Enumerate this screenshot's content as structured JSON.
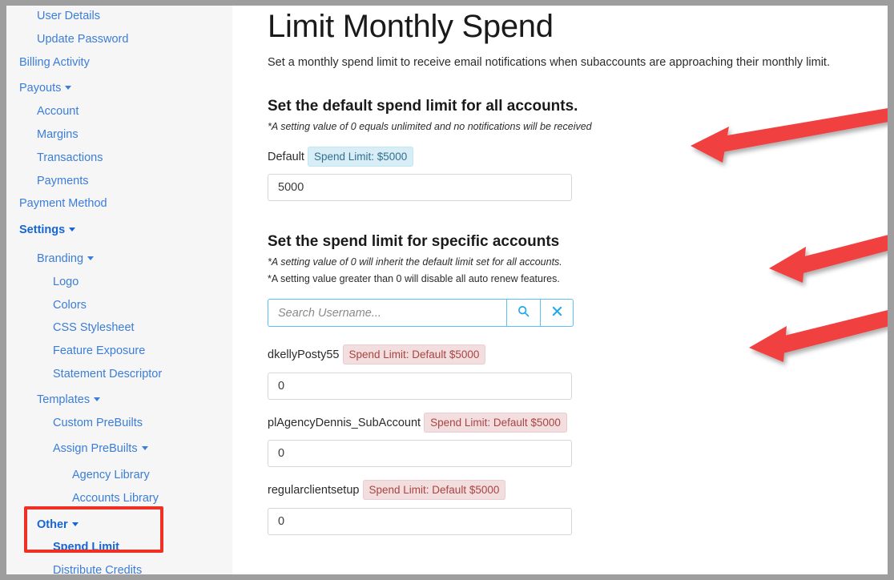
{
  "sidebar": {
    "items": [
      {
        "label": "User Details",
        "level": 2,
        "bold": false,
        "caret": false
      },
      {
        "label": "Update Password",
        "level": 2,
        "bold": false,
        "caret": false
      },
      {
        "label": "Billing Activity",
        "level": 1,
        "bold": false,
        "caret": false
      },
      {
        "label": "Payouts",
        "level": 1,
        "bold": false,
        "caret": true
      },
      {
        "label": "Account",
        "level": 2,
        "bold": false,
        "caret": false
      },
      {
        "label": "Margins",
        "level": 2,
        "bold": false,
        "caret": false
      },
      {
        "label": "Transactions",
        "level": 2,
        "bold": false,
        "caret": false
      },
      {
        "label": "Payments",
        "level": 2,
        "bold": false,
        "caret": false
      },
      {
        "label": "Payment Method",
        "level": 1,
        "bold": false,
        "caret": false
      },
      {
        "label": "Settings",
        "level": 1,
        "bold": true,
        "caret": true
      },
      {
        "label": "Branding",
        "level": 2,
        "bold": false,
        "caret": true
      },
      {
        "label": "Logo",
        "level": 3,
        "bold": false,
        "caret": false
      },
      {
        "label": "Colors",
        "level": 3,
        "bold": false,
        "caret": false
      },
      {
        "label": "CSS Stylesheet",
        "level": 3,
        "bold": false,
        "caret": false
      },
      {
        "label": "Feature Exposure",
        "level": 3,
        "bold": false,
        "caret": false
      },
      {
        "label": "Statement Descriptor",
        "level": 3,
        "bold": false,
        "caret": false
      },
      {
        "label": "Templates",
        "level": 2,
        "bold": false,
        "caret": true
      },
      {
        "label": "Custom PreBuilts",
        "level": 3,
        "bold": false,
        "caret": false
      },
      {
        "label": "Assign PreBuilts",
        "level": 3,
        "bold": false,
        "caret": true
      },
      {
        "label": "Agency Library",
        "level": 4,
        "bold": false,
        "caret": false
      },
      {
        "label": "Accounts Library",
        "level": 4,
        "bold": false,
        "caret": false
      },
      {
        "label": "Other",
        "level": 2,
        "bold": true,
        "caret": true
      },
      {
        "label": "Spend Limit",
        "level": 3,
        "bold": true,
        "caret": false
      },
      {
        "label": "Distribute Credits",
        "level": 3,
        "bold": false,
        "caret": false
      }
    ],
    "highlight_color": "#ee3124",
    "link_color": "#3b7dd8"
  },
  "main": {
    "title": "Limit Monthly Spend",
    "subtitle": "Set a monthly spend limit to receive email notifications when subaccounts are approaching their monthly limit.",
    "default_section": {
      "heading": "Set the default spend limit for all accounts.",
      "note": "*A setting value of 0 equals unlimited and no notifications will be received",
      "label": "Default",
      "badge": "Spend Limit: $5000",
      "input_value": "5000"
    },
    "specific_section": {
      "heading": "Set the spend limit for specific accounts",
      "note1": "*A setting value of 0 will inherit the default limit set for all accounts.",
      "note2": "*A setting value greater than 0 will disable all auto renew features.",
      "search_placeholder": "Search Username...",
      "search_value": "",
      "search_icon": "search-icon",
      "clear_icon": "close-icon",
      "accounts": [
        {
          "name": "dkellyPosty55",
          "badge": "Spend Limit: Default $5000",
          "value": "0"
        },
        {
          "name": "plAgencyDennis_SubAccount",
          "badge": "Spend Limit: Default $5000",
          "value": "0"
        },
        {
          "name": "regularclientsetup",
          "badge": "Spend Limit: Default $5000",
          "value": "0"
        }
      ]
    }
  },
  "annotations": {
    "arrow_color": "#f04040",
    "arrows": [
      {
        "name": "arrow-to-default-badge"
      },
      {
        "name": "arrow-to-auto-renew-note"
      },
      {
        "name": "arrow-to-account-badge"
      }
    ]
  }
}
